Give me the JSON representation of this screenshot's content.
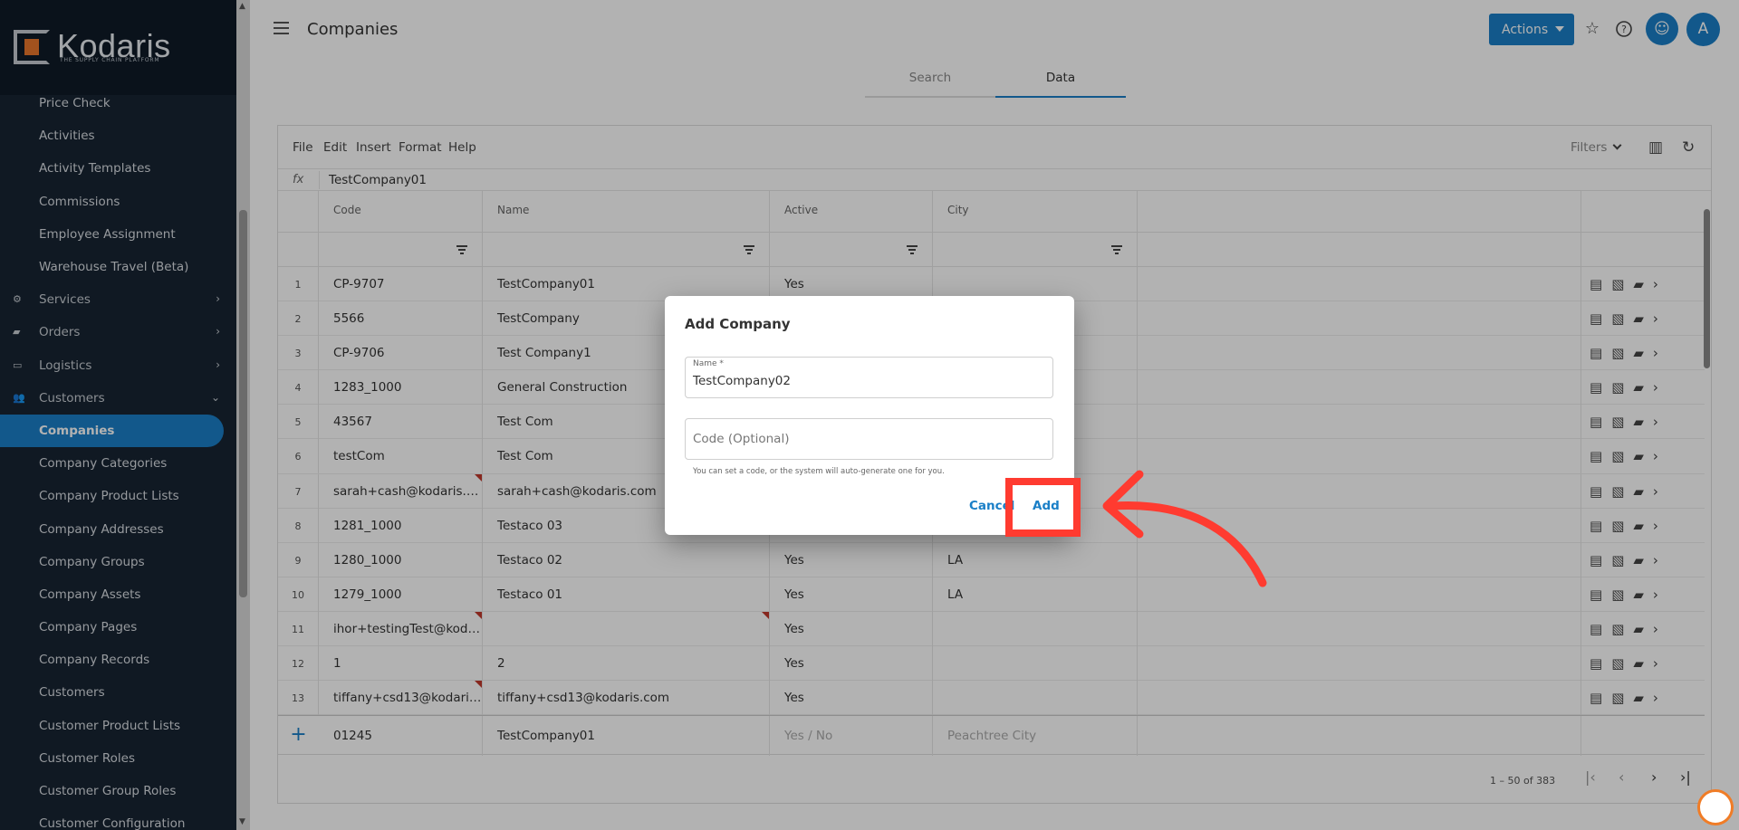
{
  "brand": {
    "name": "Kodaris",
    "tagline": "THE SUPPLY CHAIN PLATFORM"
  },
  "sidebar": {
    "items": [
      {
        "label": "Price Check",
        "type": "link"
      },
      {
        "label": "Activities",
        "type": "link"
      },
      {
        "label": "Activity Templates",
        "type": "link"
      },
      {
        "label": "Commissions",
        "type": "link"
      },
      {
        "label": "Employee Assignment",
        "type": "link"
      },
      {
        "label": "Warehouse Travel (Beta)",
        "type": "link"
      },
      {
        "label": "Services",
        "type": "group",
        "icon": "services-icon",
        "expanded": false
      },
      {
        "label": "Orders",
        "type": "group",
        "icon": "truck-icon",
        "expanded": false
      },
      {
        "label": "Logistics",
        "type": "group",
        "icon": "logistics-icon",
        "expanded": false
      },
      {
        "label": "Customers",
        "type": "group",
        "icon": "people-icon",
        "expanded": true
      },
      {
        "label": "Companies",
        "type": "link",
        "active": true
      },
      {
        "label": "Company Categories",
        "type": "link"
      },
      {
        "label": "Company Product Lists",
        "type": "link"
      },
      {
        "label": "Company Addresses",
        "type": "link"
      },
      {
        "label": "Company Groups",
        "type": "link"
      },
      {
        "label": "Company Assets",
        "type": "link"
      },
      {
        "label": "Company Pages",
        "type": "link"
      },
      {
        "label": "Company Records",
        "type": "link"
      },
      {
        "label": "Customers",
        "type": "link"
      },
      {
        "label": "Customer Product Lists",
        "type": "link"
      },
      {
        "label": "Customer Roles",
        "type": "link"
      },
      {
        "label": "Customer Group Roles",
        "type": "link"
      },
      {
        "label": "Customer Configuration",
        "type": "link"
      }
    ]
  },
  "header": {
    "title": "Companies",
    "actions_label": "Actions",
    "avatar_initial": "A"
  },
  "tabs": [
    {
      "label": "Search",
      "active": false
    },
    {
      "label": "Data",
      "active": true
    }
  ],
  "grid": {
    "menu": [
      "File",
      "Edit",
      "Insert",
      "Format",
      "Help"
    ],
    "filters_label": "Filters",
    "fx_label": "fx",
    "fx_value": "TestCompany01",
    "columns": [
      "Code",
      "Name",
      "Active",
      "City"
    ],
    "rows": [
      {
        "n": "1",
        "code": "CP-9707",
        "name": "TestCompany01",
        "active": "Yes",
        "city": ""
      },
      {
        "n": "2",
        "code": "5566",
        "name": "TestCompany",
        "active": "",
        "city": ""
      },
      {
        "n": "3",
        "code": "CP-9706",
        "name": "Test Company1",
        "active": "",
        "city": ""
      },
      {
        "n": "4",
        "code": "1283_1000",
        "name": "General Construction",
        "active": "",
        "city": ""
      },
      {
        "n": "5",
        "code": "43567",
        "name": "Test Com",
        "active": "",
        "city": ""
      },
      {
        "n": "6",
        "code": "testCom",
        "name": "Test Com",
        "active": "",
        "city": ""
      },
      {
        "n": "7",
        "code": "sarah+cash@kodaris.com",
        "name": "sarah+cash@kodaris.com",
        "active": "",
        "city": "",
        "flag_code": true
      },
      {
        "n": "8",
        "code": "1281_1000",
        "name": "Testaco 03",
        "active": "",
        "city": ""
      },
      {
        "n": "9",
        "code": "1280_1000",
        "name": "Testaco 02",
        "active": "Yes",
        "city": "LA"
      },
      {
        "n": "10",
        "code": "1279_1000",
        "name": "Testaco 01",
        "active": "Yes",
        "city": "LA"
      },
      {
        "n": "11",
        "code": "ihor+testingTest@kodari...",
        "name": "",
        "active": "Yes",
        "city": "",
        "flag_code": true,
        "flag_name": true
      },
      {
        "n": "12",
        "code": "1",
        "name": "2",
        "active": "Yes",
        "city": ""
      },
      {
        "n": "13",
        "code": "tiffany+csd13@kodaris.c...",
        "name": "tiffany+csd13@kodaris.com",
        "active": "Yes",
        "city": "",
        "flag_code": true
      }
    ],
    "new_row": {
      "code": "01245",
      "name": "TestCompany01",
      "active_placeholder": "Yes / No",
      "city_placeholder": "Peachtree City"
    },
    "pager_text": "1 – 50 of 383"
  },
  "dialog": {
    "title": "Add Company",
    "name_label": "Name *",
    "name_value": "TestCompany02",
    "code_placeholder": "Code (Optional)",
    "hint": "You can set a code, or the system will auto-generate one for you.",
    "cancel_label": "Cancel",
    "add_label": "Add"
  },
  "annotation_color": "#ff3b30",
  "accent_color": "#1a7fc7"
}
